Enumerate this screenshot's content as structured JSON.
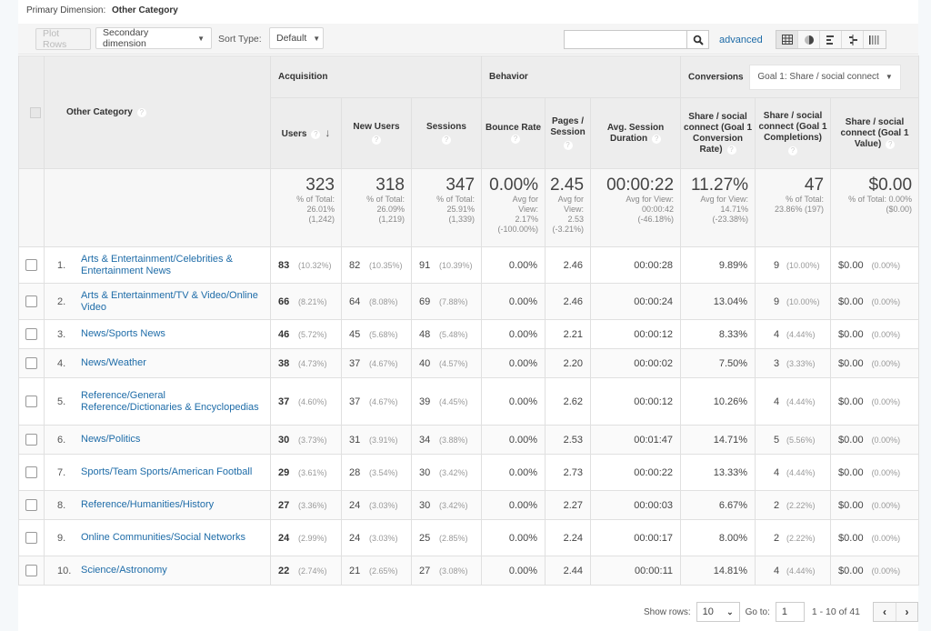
{
  "primary_dimension": {
    "label": "Primary Dimension:",
    "value": "Other Category"
  },
  "toolbar": {
    "plot_rows": "Plot Rows",
    "secondary_dimension": "Secondary dimension",
    "sort_type_label": "Sort Type:",
    "sort_type_value": "Default",
    "search_placeholder": "",
    "search_icon": "search-icon",
    "advanced": "advanced",
    "views": [
      {
        "name": "table-view",
        "glyph": "▦"
      },
      {
        "name": "pie-view",
        "glyph": "◐"
      },
      {
        "name": "bar-view",
        "glyph": "≡"
      },
      {
        "name": "comparison-view",
        "glyph": "⊥"
      },
      {
        "name": "pivot-view",
        "glyph": "⁞⁞⁞"
      }
    ]
  },
  "table": {
    "dimension_header": "Other Category",
    "groups": {
      "acquisition": "Acquisition",
      "behavior": "Behavior",
      "conversions": "Conversions",
      "goal_select": "Goal 1: Share / social connect"
    },
    "columns": {
      "users": "Users",
      "new_users": "New Users",
      "sessions": "Sessions",
      "bounce_rate": "Bounce Rate",
      "pages_session": "Pages / Session",
      "avg_duration": "Avg. Session Duration",
      "conv_rate": "Share / social connect (Goal 1 Conversion Rate)",
      "completions": "Share / social connect (Goal 1 Completions)",
      "value": "Share / social connect (Goal 1 Value)"
    },
    "totals": {
      "users": {
        "big": "323",
        "l1": "% of Total:",
        "l2": "26.01%",
        "l3": "(1,242)"
      },
      "new_users": {
        "big": "318",
        "l1": "% of Total:",
        "l2": "26.09%",
        "l3": "(1,219)"
      },
      "sessions": {
        "big": "347",
        "l1": "% of Total:",
        "l2": "25.91%",
        "l3": "(1,339)"
      },
      "bounce_rate": {
        "big": "0.00%",
        "l1": "Avg for",
        "l2": "View:",
        "l3": "2.17%",
        "l4": "(-100.00%)"
      },
      "pages_session": {
        "big": "2.45",
        "l1": "Avg for",
        "l2": "View:",
        "l3": "2.53",
        "l4": "(-3.21%)"
      },
      "avg_duration": {
        "big": "00:00:22",
        "l1": "Avg for View:",
        "l2": "00:00:42",
        "l3": "(-46.18%)"
      },
      "conv_rate": {
        "big": "11.27%",
        "l1": "Avg for View:",
        "l2": "14.71%",
        "l3": "(-23.38%)"
      },
      "completions": {
        "big": "47",
        "l1": "% of Total:",
        "l2": "23.86% (197)"
      },
      "value": {
        "big": "$0.00",
        "l1": "% of Total: 0.00%",
        "l2": "($0.00)"
      }
    },
    "rows": [
      {
        "idx": "1.",
        "name": "Arts & Entertainment/Celebrities & Entertainment News",
        "users": "83",
        "users_p": "(10.32%)",
        "new_users": "82",
        "new_users_p": "(10.35%)",
        "sessions": "91",
        "sessions_p": "(10.39%)",
        "bounce": "0.00%",
        "pages": "2.46",
        "duration": "00:00:28",
        "conv": "9.89%",
        "comp": "9",
        "comp_p": "(10.00%)",
        "value": "$0.00",
        "value_p": "(0.00%)"
      },
      {
        "idx": "2.",
        "name": "Arts & Entertainment/TV & Video/Online Video",
        "users": "66",
        "users_p": "(8.21%)",
        "new_users": "64",
        "new_users_p": "(8.08%)",
        "sessions": "69",
        "sessions_p": "(7.88%)",
        "bounce": "0.00%",
        "pages": "2.46",
        "duration": "00:00:24",
        "conv": "13.04%",
        "comp": "9",
        "comp_p": "(10.00%)",
        "value": "$0.00",
        "value_p": "(0.00%)"
      },
      {
        "idx": "3.",
        "name": "News/Sports News",
        "users": "46",
        "users_p": "(5.72%)",
        "new_users": "45",
        "new_users_p": "(5.68%)",
        "sessions": "48",
        "sessions_p": "(5.48%)",
        "bounce": "0.00%",
        "pages": "2.21",
        "duration": "00:00:12",
        "conv": "8.33%",
        "comp": "4",
        "comp_p": "(4.44%)",
        "value": "$0.00",
        "value_p": "(0.00%)"
      },
      {
        "idx": "4.",
        "name": "News/Weather",
        "users": "38",
        "users_p": "(4.73%)",
        "new_users": "37",
        "new_users_p": "(4.67%)",
        "sessions": "40",
        "sessions_p": "(4.57%)",
        "bounce": "0.00%",
        "pages": "2.20",
        "duration": "00:00:02",
        "conv": "7.50%",
        "comp": "3",
        "comp_p": "(3.33%)",
        "value": "$0.00",
        "value_p": "(0.00%)"
      },
      {
        "idx": "5.",
        "name": "Reference/General Reference/Dictionaries & Encyclopedias",
        "users": "37",
        "users_p": "(4.60%)",
        "new_users": "37",
        "new_users_p": "(4.67%)",
        "sessions": "39",
        "sessions_p": "(4.45%)",
        "bounce": "0.00%",
        "pages": "2.62",
        "duration": "00:00:12",
        "conv": "10.26%",
        "comp": "4",
        "comp_p": "(4.44%)",
        "value": "$0.00",
        "value_p": "(0.00%)"
      },
      {
        "idx": "6.",
        "name": "News/Politics",
        "users": "30",
        "users_p": "(3.73%)",
        "new_users": "31",
        "new_users_p": "(3.91%)",
        "sessions": "34",
        "sessions_p": "(3.88%)",
        "bounce": "0.00%",
        "pages": "2.53",
        "duration": "00:01:47",
        "conv": "14.71%",
        "comp": "5",
        "comp_p": "(5.56%)",
        "value": "$0.00",
        "value_p": "(0.00%)"
      },
      {
        "idx": "7.",
        "name": "Sports/Team Sports/American Football",
        "users": "29",
        "users_p": "(3.61%)",
        "new_users": "28",
        "new_users_p": "(3.54%)",
        "sessions": "30",
        "sessions_p": "(3.42%)",
        "bounce": "0.00%",
        "pages": "2.73",
        "duration": "00:00:22",
        "conv": "13.33%",
        "comp": "4",
        "comp_p": "(4.44%)",
        "value": "$0.00",
        "value_p": "(0.00%)"
      },
      {
        "idx": "8.",
        "name": "Reference/Humanities/History",
        "users": "27",
        "users_p": "(3.36%)",
        "new_users": "24",
        "new_users_p": "(3.03%)",
        "sessions": "30",
        "sessions_p": "(3.42%)",
        "bounce": "0.00%",
        "pages": "2.27",
        "duration": "00:00:03",
        "conv": "6.67%",
        "comp": "2",
        "comp_p": "(2.22%)",
        "value": "$0.00",
        "value_p": "(0.00%)"
      },
      {
        "idx": "9.",
        "name": "Online Communities/Social Networks",
        "users": "24",
        "users_p": "(2.99%)",
        "new_users": "24",
        "new_users_p": "(3.03%)",
        "sessions": "25",
        "sessions_p": "(2.85%)",
        "bounce": "0.00%",
        "pages": "2.24",
        "duration": "00:00:17",
        "conv": "8.00%",
        "comp": "2",
        "comp_p": "(2.22%)",
        "value": "$0.00",
        "value_p": "(0.00%)"
      },
      {
        "idx": "10.",
        "name": "Science/Astronomy",
        "users": "22",
        "users_p": "(2.74%)",
        "new_users": "21",
        "new_users_p": "(2.65%)",
        "sessions": "27",
        "sessions_p": "(3.08%)",
        "bounce": "0.00%",
        "pages": "2.44",
        "duration": "00:00:11",
        "conv": "14.81%",
        "comp": "4",
        "comp_p": "(4.44%)",
        "value": "$0.00",
        "value_p": "(0.00%)"
      }
    ]
  },
  "pager": {
    "show_rows_label": "Show rows:",
    "show_rows_value": "10",
    "goto_label": "Go to:",
    "goto_value": "1",
    "range": "1 - 10 of 41",
    "prev": "‹",
    "next": "›"
  },
  "colors": {
    "link": "#1e6ca8",
    "header_bg": "#ededed"
  }
}
